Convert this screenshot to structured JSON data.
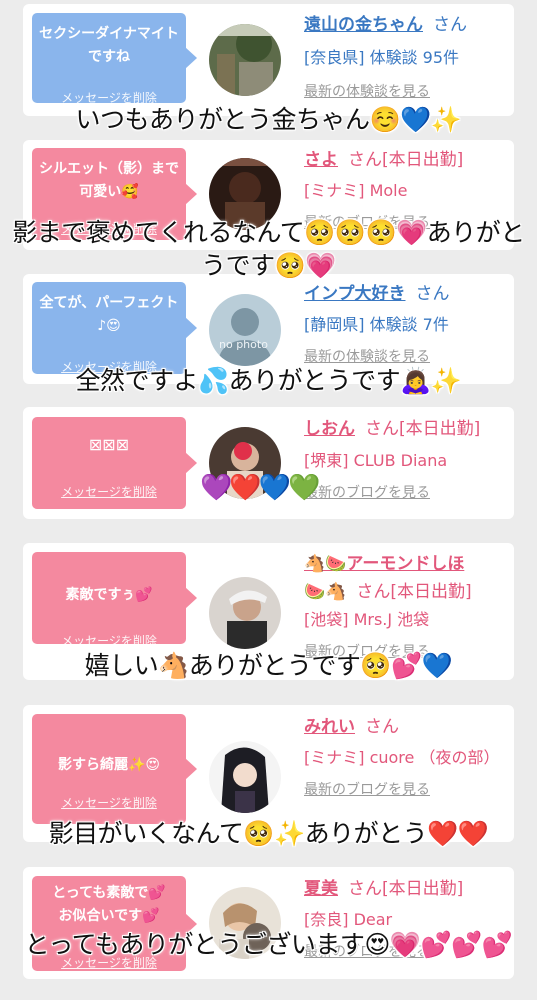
{
  "delete_label": "メッセージを削除",
  "cards": [
    {
      "bubble_color": "#8ab5ec",
      "message": "セクシーダイナマイトですね",
      "name": "遠山の金ちゃん",
      "san": "さん",
      "detail": "[奈良県] 体験談 95件",
      "link": "最新の体験談を見る",
      "overlay": "いつもありがとう金ちゃん☺️💙✨"
    },
    {
      "bubble_color": "#f4899f",
      "message": "シルエット（影）まで可愛い🥰",
      "name": "さよ",
      "san": "さん[本日出勤]",
      "detail": "[ミナミ] Mole",
      "link": "最新のブログを見る",
      "overlay": "影まで褒めてくれるなんて🥺🥺🥺💗ありがとうです🥺💗"
    },
    {
      "bubble_color": "#8ab5ec",
      "message": "全てが、パーフェクト♪😍",
      "name": "インプ大好き",
      "san": "さん",
      "detail": "[静岡県] 体験談 7件",
      "link": "最新の体験談を見る",
      "avatar_text": "no photo",
      "overlay": "全然ですよ💦ありがとうです🙇‍♀️✨"
    },
    {
      "bubble_color": "#f4899f",
      "message": "⊠⊠⊠",
      "name": "しおん",
      "san": "さん[本日出勤]",
      "detail": "[堺東] CLUB Diana",
      "link": "最新のブログを見る",
      "hearts": "💜❤️💙💚"
    },
    {
      "bubble_color": "#f4899f",
      "message": "素敵ですぅ💕",
      "name": "🐴🍉アーモンドしほ",
      "name2": "🍉🐴",
      "san": "さん[本日出勤]",
      "detail": "[池袋] Mrs.J 池袋",
      "link": "最新のブログを見る",
      "overlay": "嬉しい🐴ありがとうです🥺💕💙"
    },
    {
      "bubble_color": "#f4899f",
      "message": "影すら綺麗✨😍",
      "name": "みれい",
      "san": "さん",
      "detail": "[ミナミ] cuore （夜の部）",
      "link": "最新のブログを見る",
      "overlay": "影目がいくなんて🥺✨ありがとう❤️❤️"
    },
    {
      "bubble_color": "#f4899f",
      "message": "とっても素敵で💕お似合いです💕",
      "name": "夏美",
      "san": "さん[本日出勤]",
      "detail": "[奈良] Dear",
      "link": "最新のブログを見る",
      "overlay": "とってもありがとうございます😍💗💕💕💕"
    }
  ]
}
